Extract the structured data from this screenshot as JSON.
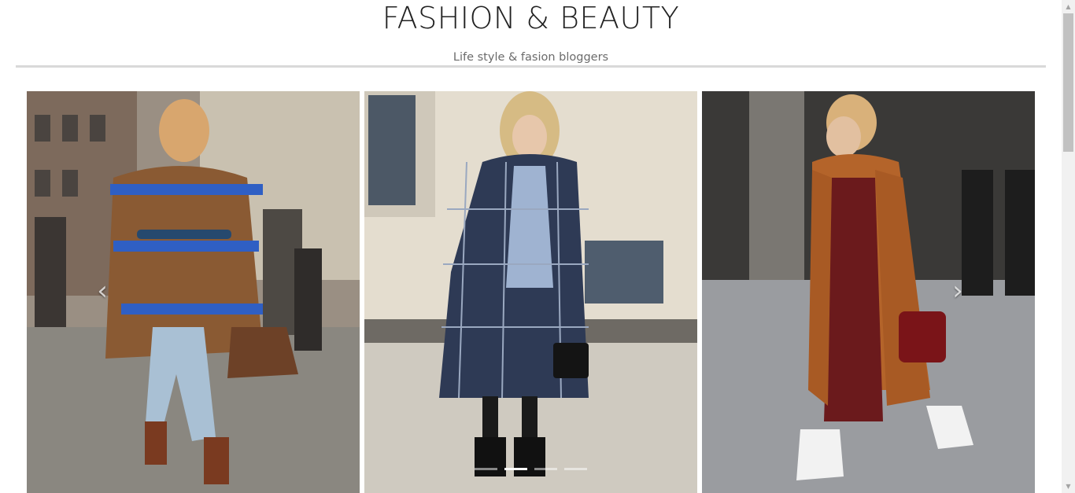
{
  "header": {
    "title": "FASHION & BEAUTY",
    "tagline": "Life style & fasion bloggers"
  },
  "carousel": {
    "slides": [
      {
        "name": "street-style-fur-coat-photo",
        "palette": [
          "#8a5a33",
          "#2f5fc4",
          "#a9c0d4",
          "#7a7a73"
        ]
      },
      {
        "name": "plaid-coat-photo",
        "palette": [
          "#2e3a55",
          "#9fb3d1",
          "#141414",
          "#cfcabf"
        ]
      },
      {
        "name": "rust-trench-coat-photo",
        "palette": [
          "#b4642a",
          "#6b1a1c",
          "#f2f2f2",
          "#8d9092"
        ]
      }
    ],
    "prev_icon": "chevron-left-icon",
    "next_icon": "chevron-right-icon",
    "indicators": [
      false,
      true,
      false,
      false
    ],
    "active_index": 1
  },
  "scrollbar": {
    "up_glyph": "▲",
    "down_glyph": "▼"
  }
}
